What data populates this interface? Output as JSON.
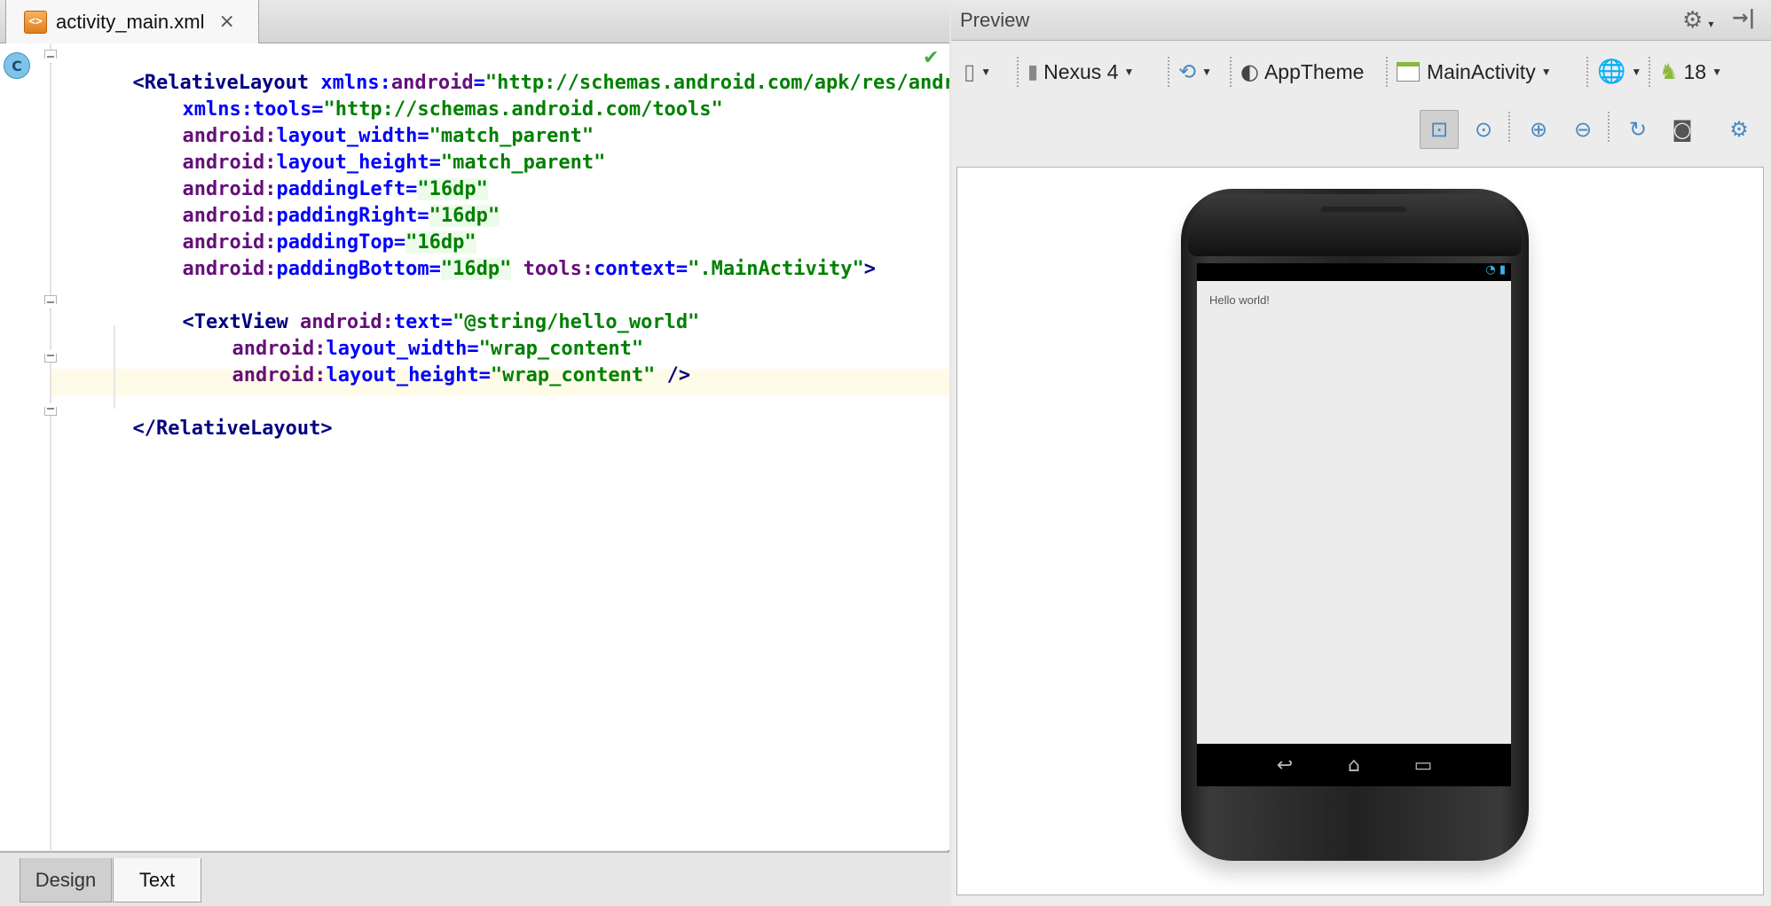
{
  "editor": {
    "tab_label": "activity_main.xml",
    "close_glyph": "×",
    "class_badge": "C",
    "bottom_tabs": [
      {
        "label": "Design"
      },
      {
        "label": "Text"
      }
    ]
  },
  "code": {
    "l1": {
      "open": "<",
      "tag": "RelativeLayout",
      "ns": "xmlns:",
      "attr": "android",
      "eq": "=",
      "val": "\"http://schemas.android.com/apk/res/andro"
    },
    "l2": {
      "ns": "xmlns:",
      "attr": "tools",
      "eq": "=",
      "val": "\"http://schemas.android.com/tools\""
    },
    "l3": {
      "ns": "android:",
      "attr": "layout_width",
      "eq": "=",
      "val": "\"match_parent\""
    },
    "l4": {
      "ns": "android:",
      "attr": "layout_height",
      "eq": "=",
      "val": "\"match_parent\""
    },
    "l5": {
      "ns": "android:",
      "attr": "paddingLeft",
      "eq": "=",
      "val": "\"16dp\""
    },
    "l6": {
      "ns": "android:",
      "attr": "paddingRight",
      "eq": "=",
      "val": "\"16dp\""
    },
    "l7": {
      "ns": "android:",
      "attr": "paddingTop",
      "eq": "=",
      "val": "\"16dp\""
    },
    "l8": {
      "ns": "android:",
      "attr": "paddingBottom",
      "eq": "=",
      "val": "\"16dp\"",
      "ns2": "tools:",
      "attr2": "context",
      "eq2": "=",
      "val2": "\".MainActivity\"",
      "close": ">"
    },
    "l10": {
      "open": "<",
      "tag": "TextView",
      "ns": "android:",
      "attr": "text",
      "eq": "=",
      "val": "\"@string/hello_world\""
    },
    "l11": {
      "ns": "android:",
      "attr": "layout_width",
      "eq": "=",
      "val": "\"wrap_content\""
    },
    "l12": {
      "ns": "android:",
      "attr": "layout_height",
      "eq": "=",
      "val": "\"wrap_content\"",
      "close": " />"
    },
    "l14": {
      "open": "</",
      "tag": "RelativeLayout",
      "close": ">"
    }
  },
  "preview": {
    "title": "Preview",
    "toolbar": {
      "device": "Nexus 4",
      "theme": "AppTheme",
      "activity": "MainActivity",
      "api_level": "18"
    },
    "device_screen": {
      "content_text": "Hello world!"
    }
  },
  "colors": {
    "tag": "#000080",
    "namespace": "#660e7a",
    "attribute": "#0000ff",
    "value": "#008000",
    "current_line": "#fefbe8",
    "selection_badge": "#7fc3e8"
  },
  "icons": [
    "xml-file-icon",
    "close-icon",
    "class-badge-icon",
    "check-icon",
    "fold-icon",
    "gear-icon",
    "pin-icon",
    "device-config-icon",
    "orientation-icon",
    "theme-icon",
    "layout-icon",
    "locale-icon",
    "android-icon",
    "zoom-fit-icon",
    "zoom-actual-icon",
    "zoom-in-icon",
    "zoom-out-icon",
    "refresh-icon",
    "camera-icon",
    "settings-icon",
    "back-icon",
    "home-icon",
    "recents-icon",
    "wifi-icon",
    "battery-icon"
  ]
}
